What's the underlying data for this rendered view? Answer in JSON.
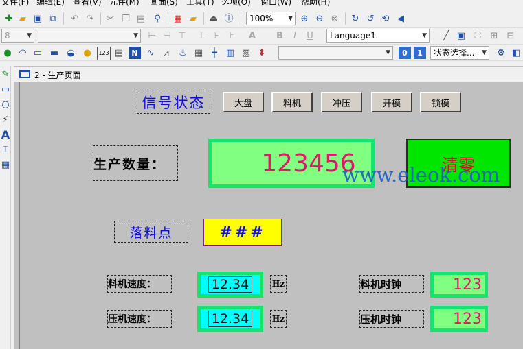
{
  "menubar": [
    "文件(F)",
    "编辑(E)",
    "查看(V)",
    "元件(M)",
    "画面(S)",
    "工具(T)",
    "选项(O)",
    "窗口(W)",
    "帮助(H)"
  ],
  "toolbar1": {
    "zoom": "100%"
  },
  "toolbar2": {
    "font_size": "8",
    "font_name": "",
    "language": "Language1"
  },
  "toolbar3": {
    "state_select": "状态选择...",
    "btn0": "0",
    "btn1": "1",
    "num123": "123"
  },
  "window": {
    "title": "2 - 生产页面"
  },
  "screen": {
    "signal_status": "信号状态",
    "buttons": [
      "大盘",
      "料机",
      "冲压",
      "开模",
      "锁模"
    ],
    "production_label": "生产数量：",
    "production_value": "123456",
    "reset_button": "清零",
    "drop_point_label": "落料点",
    "drop_point_value": "###",
    "feeder_speed_label": "料机速度：",
    "feeder_speed_value": "12.34",
    "feeder_speed_unit": "Hz",
    "press_speed_label": "压机速度：",
    "press_speed_value": "12.34",
    "press_speed_unit": "Hz",
    "feeder_clock_label": "料机时钟",
    "feeder_clock_value": "123",
    "press_clock_label": "压机时钟",
    "press_clock_value": "123"
  },
  "watermark": "www.eleok.com",
  "colors": {
    "canvas": "#c0c0c0",
    "value_border": "#17e36f",
    "value_green": "#80ff80",
    "value_cyan": "#00ffff",
    "value_yellow": "#ffff00",
    "reset_bg": "#00e600",
    "reset_text": "#e0002a",
    "blue_text": "#1010e0",
    "magenta_text": "#e0176a"
  }
}
